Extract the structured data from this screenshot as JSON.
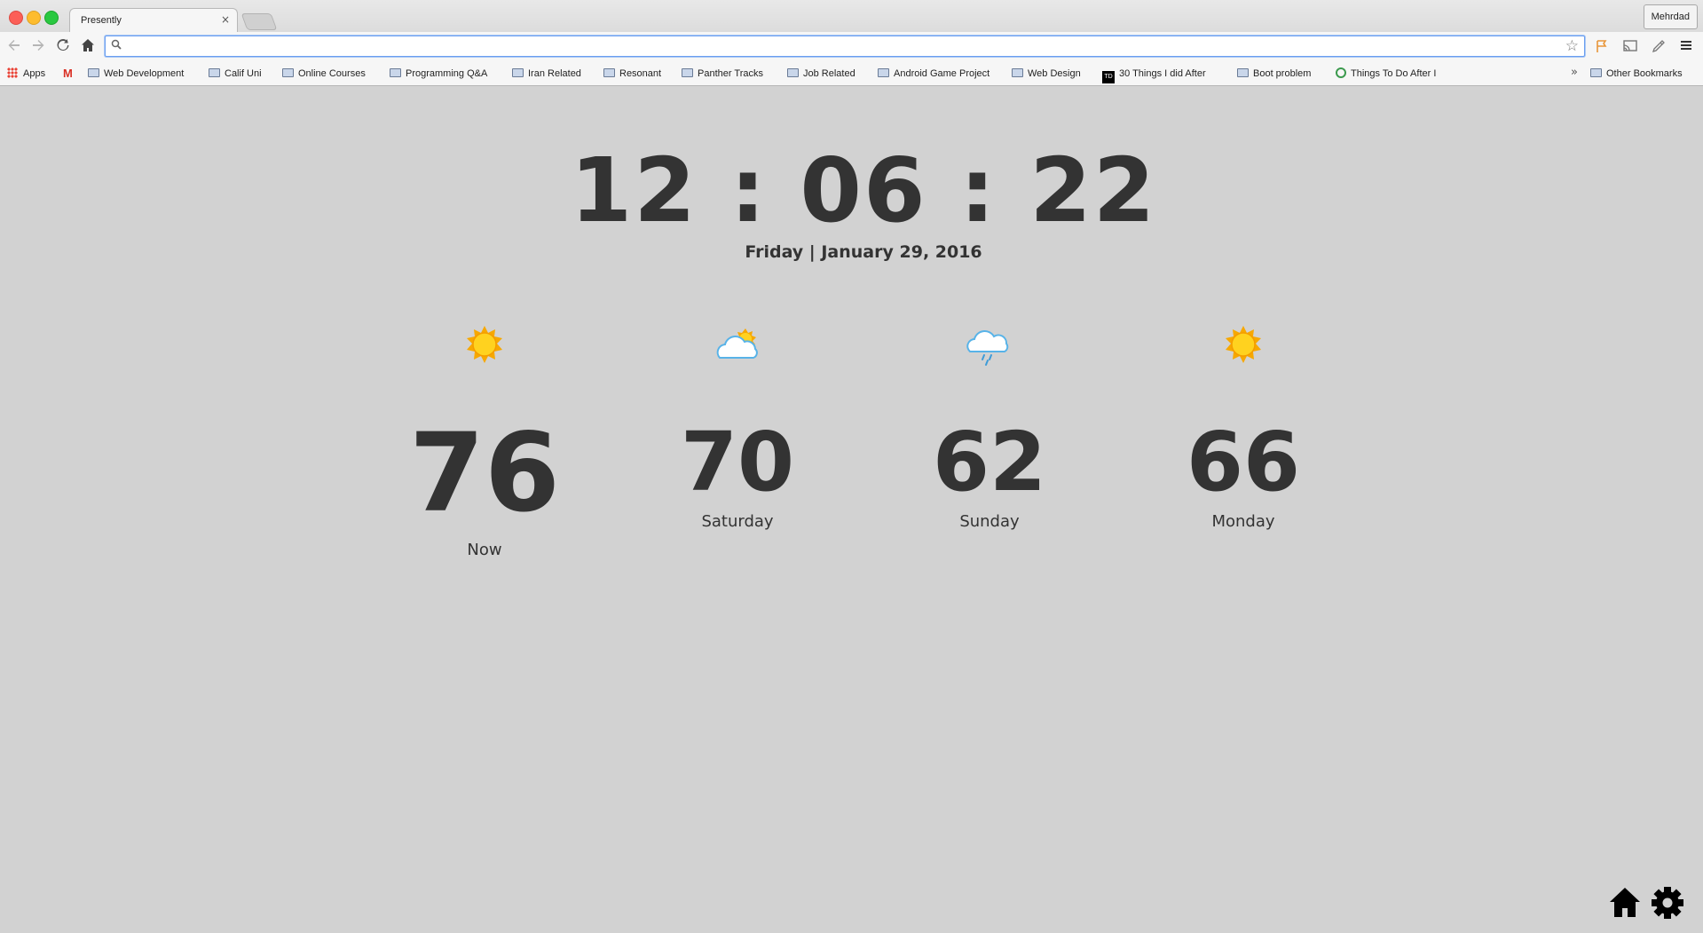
{
  "browser": {
    "tab_title": "Presently",
    "tab_close": "×",
    "profile_name": "Mehrdad",
    "omnibox_value": "",
    "bookmarks": [
      {
        "label": "Apps",
        "icon": "apps-grid-icon"
      },
      {
        "label": "",
        "icon": "gmail-icon"
      },
      {
        "label": "Web Development",
        "icon": "folder-icon"
      },
      {
        "label": "Calif Uni",
        "icon": "folder-icon"
      },
      {
        "label": "Online Courses",
        "icon": "folder-icon"
      },
      {
        "label": "Programming Q&A",
        "icon": "folder-icon"
      },
      {
        "label": "Iran Related",
        "icon": "folder-icon"
      },
      {
        "label": "Resonant",
        "icon": "folder-icon"
      },
      {
        "label": "Panther Tracks",
        "icon": "folder-icon"
      },
      {
        "label": "Job Related",
        "icon": "folder-icon"
      },
      {
        "label": "Android Game Project",
        "icon": "folder-icon"
      },
      {
        "label": "Web Design",
        "icon": "folder-icon"
      },
      {
        "label": "30 Things I did After",
        "icon": "td-site-icon"
      },
      {
        "label": "Boot problem",
        "icon": "folder-icon"
      },
      {
        "label": "Things To Do After I",
        "icon": "site-icon"
      },
      {
        "label": "Other Bookmarks",
        "icon": "folder-icon"
      }
    ],
    "overflow_chevron": "»"
  },
  "page": {
    "clock": "12 : 06 : 22",
    "date": "Friday | January 29, 2016",
    "forecast": [
      {
        "temp": "76",
        "label": "Now",
        "icon": "sun-icon"
      },
      {
        "temp": "70",
        "label": "Saturday",
        "icon": "partly-cloudy-icon"
      },
      {
        "temp": "62",
        "label": "Sunday",
        "icon": "rain-cloud-icon"
      },
      {
        "temp": "66",
        "label": "Monday",
        "icon": "sun-icon"
      }
    ]
  },
  "colors": {
    "background": "#d2d2d2",
    "text": "#333333",
    "sun": "#f7b500"
  }
}
